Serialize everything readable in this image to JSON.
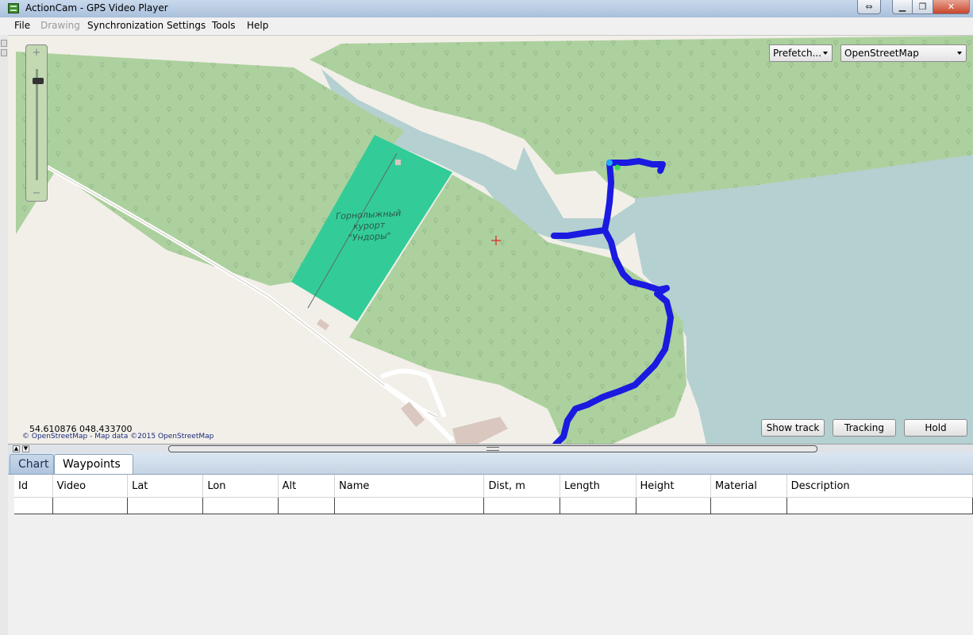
{
  "window": {
    "title": "ActionCam - GPS Video Player",
    "icon": "film-icon",
    "controls": [
      "restore-icon",
      "minimize-icon",
      "maximize-icon",
      "close-icon"
    ]
  },
  "menu": {
    "file": "File",
    "drawing": "Drawing",
    "synchronization": "Synchronization",
    "settings": "Settings",
    "tools": "Tools",
    "help": "Help"
  },
  "map": {
    "prefetch_label": "Prefetch...",
    "provider_selected": "OpenStreetMap",
    "coordinates": "54.610876   048.433700",
    "attribution": "© OpenStreetMap - Map data ©2015 OpenStreetMap",
    "place_label_line1": "Горнолыжный",
    "place_label_line2": "курорт",
    "place_label_line3": "\"Ундоры\"",
    "buttons": {
      "show_track": "Show track",
      "tracking": "Tracking",
      "hold": "Hold"
    },
    "colors": {
      "forest": "#add19e",
      "water": "#b5d0d0",
      "land": "#f2efe9",
      "pitch": "#33cc99",
      "track": "#1a1ae0",
      "track_start": "#22aaff",
      "track_end": "#33dd55",
      "center_marker": "#e02020"
    }
  },
  "tabs": {
    "chart": "Chart",
    "waypoints": "Waypoints"
  },
  "waypoints_table": {
    "columns": [
      "Id",
      "Video",
      "Lat",
      "Lon",
      "Alt",
      "Name",
      "Dist, m",
      "Length",
      "Height",
      "Material",
      "Description"
    ]
  }
}
